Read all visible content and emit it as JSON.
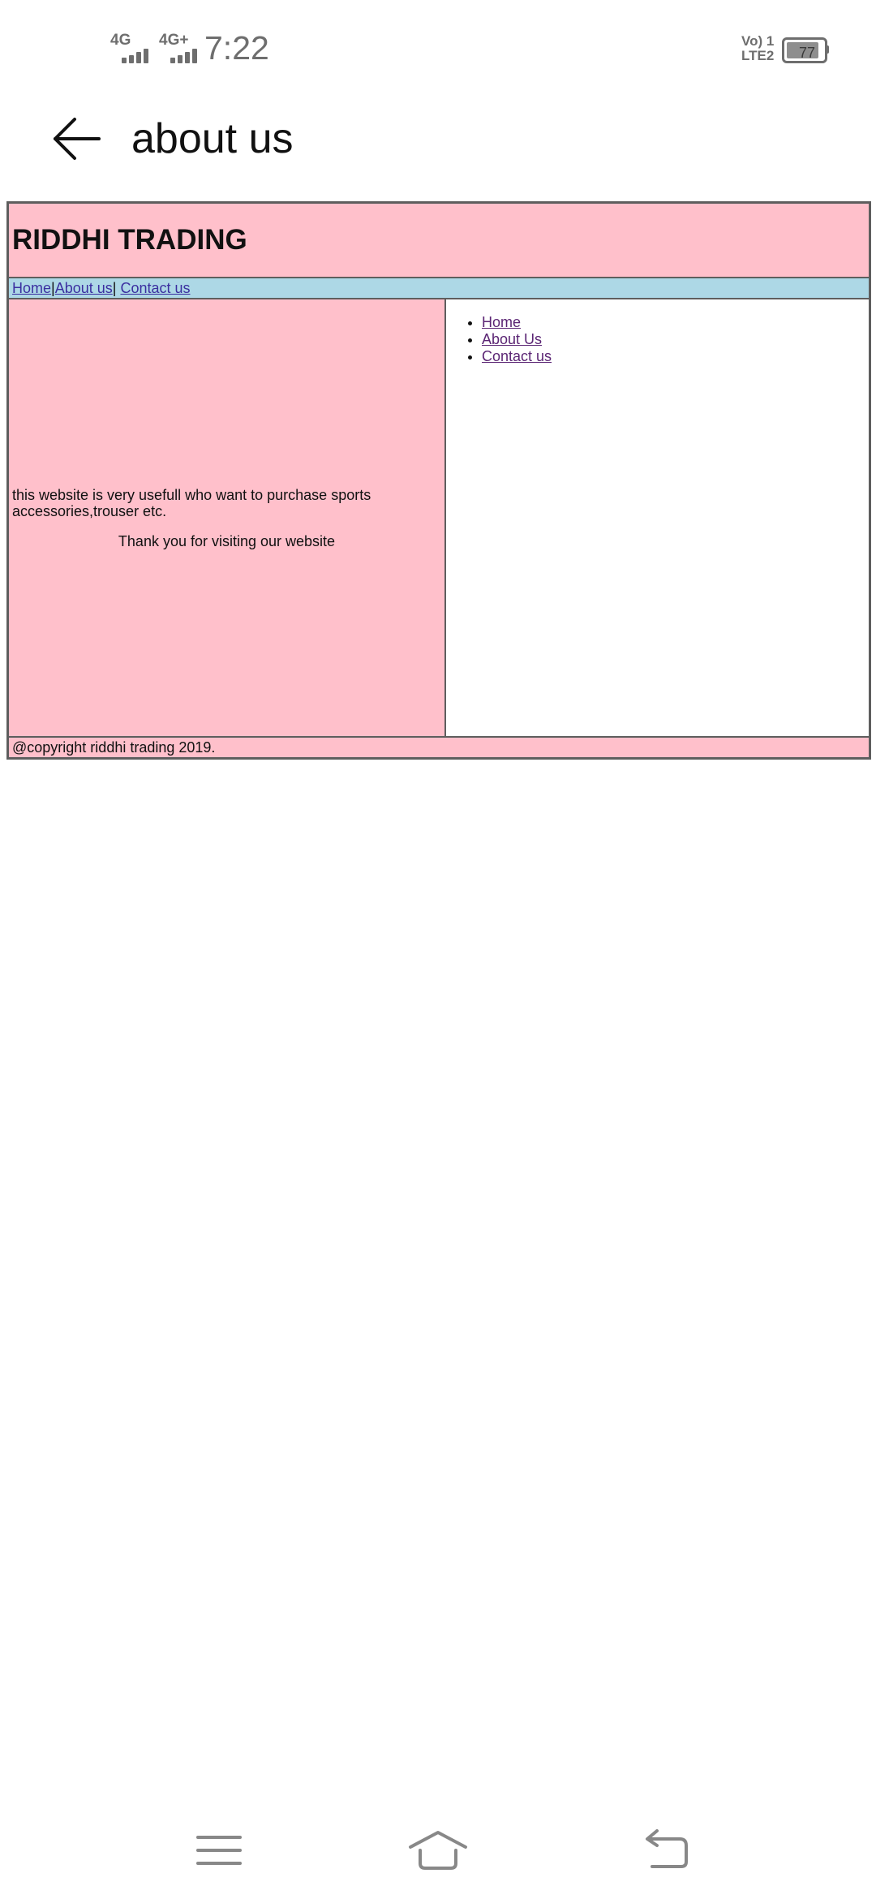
{
  "status_bar": {
    "network1": "4G",
    "network2": "4G+",
    "time": "7:22",
    "volte_line1": "Vo) 1",
    "volte_line2": "LTE2",
    "battery": "77",
    "battery_level": 0.77
  },
  "header": {
    "back_icon": "arrow-left-icon",
    "title": "about us"
  },
  "site": {
    "title": "RIDDHI TRADING",
    "nav": {
      "home": "Home",
      "sep1": "|",
      "about": "About us",
      "sep2": "|",
      "contact": "Contact us"
    },
    "content": {
      "description": "this website is very usefull who want to purchase sports accessories,trouser etc.",
      "thanks": "Thank you for visiting our website"
    },
    "side_links": [
      "Home",
      "About Us",
      "Contact us"
    ],
    "footer": "@copyright riddhi trading 2019.",
    "colors": {
      "header_bg": "#ffc0cb",
      "nav_bg": "#add8e6",
      "border": "#5e5e5e"
    }
  },
  "bottom_nav": {
    "menu_icon": "menu-icon",
    "home_icon": "home-icon",
    "back_icon": "return-icon"
  }
}
